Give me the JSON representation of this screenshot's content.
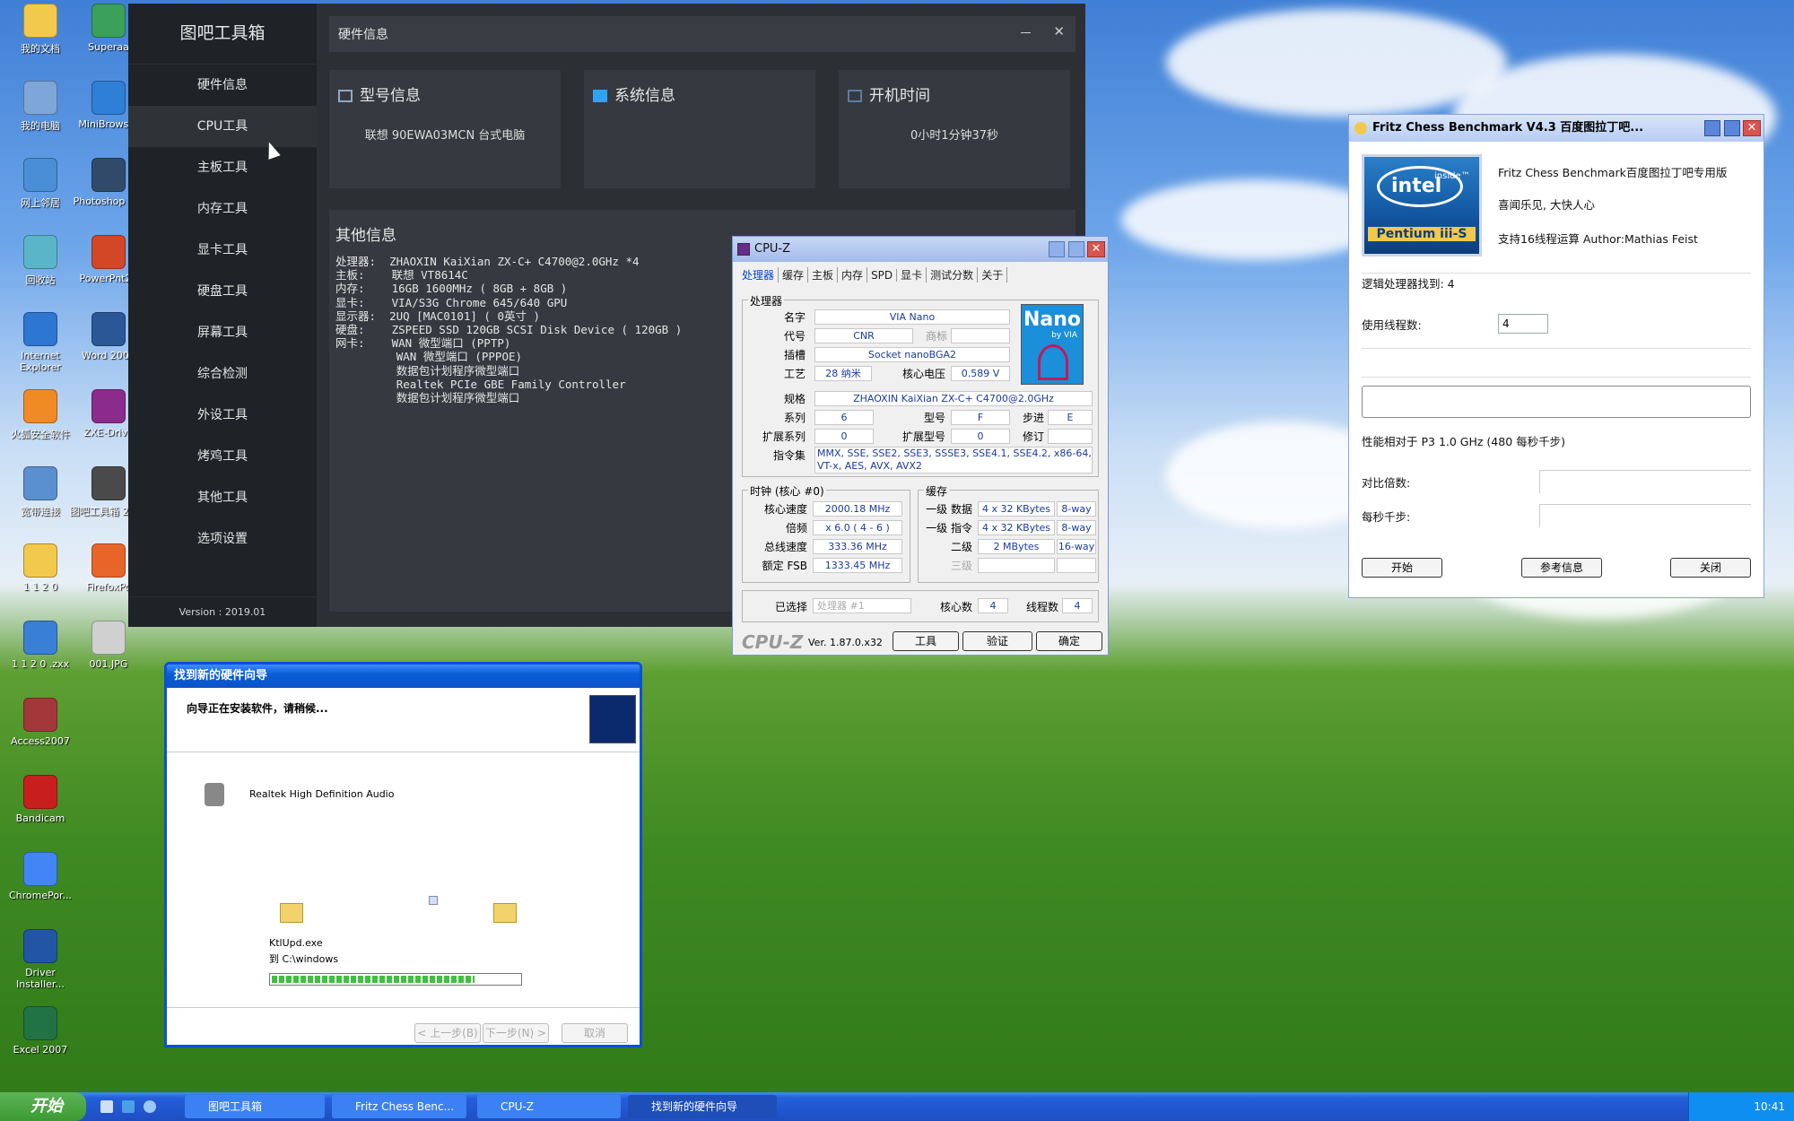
{
  "desktop": {
    "icons": [
      {
        "label": "我的文档",
        "color": "#f2c94c"
      },
      {
        "label": "Superaa",
        "color": "#3aa05a"
      },
      {
        "label": "我的电脑",
        "color": "#7fa6d8"
      },
      {
        "label": "MiniBrowser",
        "color": "#2e7fd6"
      },
      {
        "label": "网上邻居",
        "color": "#4a8ed6"
      },
      {
        "label": "Photoshop 7.0",
        "color": "#324a6a"
      },
      {
        "label": "回收站",
        "color": "#5ab5c8"
      },
      {
        "label": "PowerPnt20",
        "color": "#d24726"
      },
      {
        "label": "Internet Explorer",
        "color": "#2d76d2"
      },
      {
        "label": "Word 2007",
        "color": "#2b5797"
      },
      {
        "label": "火狐安全软件",
        "color": "#f08a24"
      },
      {
        "label": "ZXE-Drive",
        "color": "#8b2b8b"
      },
      {
        "label": "宽带连接",
        "color": "#5a8fd0"
      },
      {
        "label": "图吧工具箱 2019",
        "color": "#4a4a4a"
      },
      {
        "label": "1 1 2 0",
        "color": "#f2c94c"
      },
      {
        "label": "FirefoxPo",
        "color": "#e8652a"
      },
      {
        "label": "1 1 2 0 .zxx",
        "color": "#3a7fd6"
      },
      {
        "label": "001.JPG",
        "color": "#d0d0d0"
      },
      {
        "label": "Access2007",
        "color": "#a4373a"
      },
      {
        "label": "Bandicam",
        "color": "#c81e1e"
      },
      {
        "label": "ChromePor...",
        "color": "#4285f4"
      },
      {
        "label": "Driver Installer...",
        "color": "#2255a4"
      },
      {
        "label": "Excel 2007",
        "color": "#217346"
      }
    ]
  },
  "toolbox": {
    "brand": "图吧工具箱",
    "nav": [
      "硬件信息",
      "CPU工具",
      "主板工具",
      "内存工具",
      "显卡工具",
      "硬盘工具",
      "屏幕工具",
      "综合检测",
      "外设工具",
      "烤鸡工具",
      "其他工具",
      "选项设置"
    ],
    "version": "Version : 2019.01",
    "header": "硬件信息",
    "min": "－",
    "close": "✕",
    "cards": [
      {
        "title": "型号信息",
        "value": "联想 90EWA03MCN 台式电脑"
      },
      {
        "title": "系统信息",
        "value": ""
      },
      {
        "title": "开机时间",
        "value": "0小时1分钟37秒"
      }
    ],
    "other_title": "其他信息",
    "other_text": "处理器:  ZHAOXIN KaiXian ZX-C+ C4700@2.0GHz *4\n主板:    联想 VT8614C\n内存:    16GB 1600MHz ( 8GB + 8GB )\n显卡:    VIA/S3G Chrome 645/640 GPU\n显示器:  2UQ [MAC0101] ( 0英寸 )\n硬盘:    ZSPEED SSD 120GB SCSI Disk Device ( 120GB )\n网卡:    WAN 微型端口 (PPTP)\n         WAN 微型端口 (PPPOE)\n         数据包计划程序微型端口\n         Realtek PCIe GBE Family Controller\n         数据包计划程序微型端口"
  },
  "cpuz": {
    "title": "CPU-Z",
    "tabs": [
      "处理器",
      "缓存",
      "主板",
      "内存",
      "SPD",
      "显卡",
      "测试分数",
      "关于"
    ],
    "group_proc": "处理器",
    "name_l": "名字",
    "name": "VIA Nano",
    "code_l": "代号",
    "code": "CNR",
    "brand_l": "商标",
    "socket_l": "插槽",
    "socket": "Socket nanoBGA2",
    "tech_l": "工艺",
    "tech": "28 纳米",
    "volt_l": "核心电压",
    "volt": "0.589 V",
    "spec_l": "规格",
    "spec": "ZHAOXIN KaiXian ZX-C+ C4700@2.0GHz",
    "family_l": "系列",
    "family": "6",
    "model_l": "型号",
    "model": "F",
    "step_l": "步进",
    "step": "E",
    "extfam_l": "扩展系列",
    "extfam": "0",
    "extmod_l": "扩展型号",
    "extmod": "0",
    "rev_l": "修订",
    "instr_l": "指令集",
    "instr1": "MMX, SSE, SSE2, SSE3, SSSE3, SSE4.1, SSE4.2, x86-64,",
    "instr2": "VT-x, AES, AVX, AVX2",
    "logo_big": "Nano",
    "logo_small": "by VIA",
    "group_clk": "时钟 (核心 #0)",
    "core_l": "核心速度",
    "core": "2000.18 MHz",
    "mult_l": "倍频",
    "mult": "x 6.0 ( 4 - 6 )",
    "bus_l": "总线速度",
    "bus": "333.36 MHz",
    "fsb_l": "额定 FSB",
    "fsb": "1333.45 MHz",
    "group_cache": "缓存",
    "l1d_l": "一级 数据",
    "l1d": "4 x 32 KBytes",
    "l1d_w": "8-way",
    "l1i_l": "一级 指令",
    "l1i": "4 x 32 KBytes",
    "l1i_w": "8-way",
    "l2_l": "二级",
    "l2": "2 MBytes",
    "l2_w": "16-way",
    "l3_l": "三级",
    "sel_l": "已选择",
    "sel": "处理器 #1",
    "cores_l": "核心数",
    "cores": "4",
    "threads_l": "线程数",
    "threads": "4",
    "footer_logo": "CPU-Z",
    "ver": "Ver. 1.87.0.x32",
    "tools": "工具",
    "validate": "验证",
    "ok": "确定"
  },
  "fritz": {
    "title": "Fritz Chess Benchmark V4.3   百度图拉丁吧...",
    "logo_top": "intel",
    "logo_inside": "inside™",
    "logo_bottom": "Pentium iii-S",
    "line1": "Fritz Chess Benchmark百度图拉丁吧专用版",
    "line2": "喜闻乐见, 大快人心",
    "line3": "支持16线程运算    Author:Mathias Feist",
    "found": "逻辑处理器找到: 4",
    "threads_l": "使用线程数:",
    "threads": "4",
    "perf": "性能相对于 P3 1.0 GHz (480 每秒千步)",
    "ratio_l": "对比倍数:",
    "kps_l": "每秒千步:",
    "start": "开始",
    "info": "参考信息",
    "close": "关闭"
  },
  "wizard": {
    "title": "找到新的硬件向导",
    "msg": "向导正在安装软件，请稍候...",
    "device": "Realtek High Definition Audio",
    "file": "KtlUpd.exe",
    "dest": "到 C:\\windows",
    "progress": 0.82,
    "back": "< 上一步(B)",
    "next": "下一步(N) >",
    "cancel": "取消"
  },
  "taskbar": {
    "start": "开始",
    "items": [
      "图吧工具箱",
      "Fritz Chess Benc...",
      "CPU-Z",
      "找到新的硬件向导"
    ],
    "time": "10:41"
  }
}
